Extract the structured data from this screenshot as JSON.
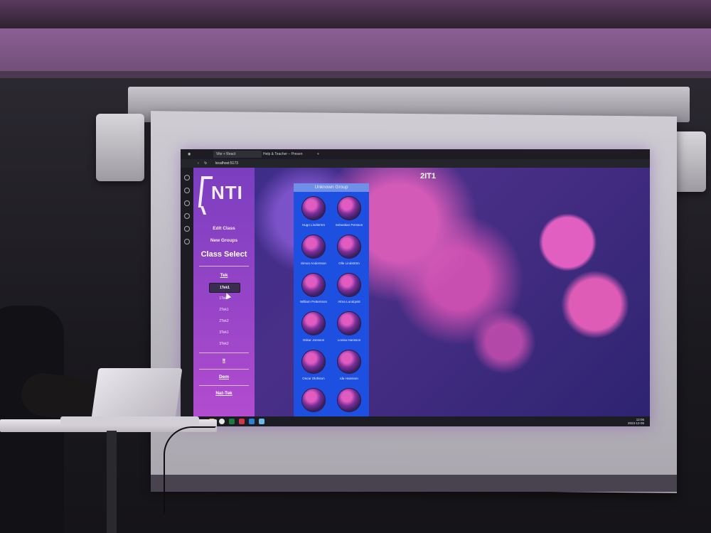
{
  "browser": {
    "tabs": [
      {
        "label": "Vite + React"
      },
      {
        "label": "Help & Teacher – Presen"
      }
    ],
    "new_tab": "+",
    "address": "localhost:5173"
  },
  "app": {
    "logo_text": "NTI",
    "nav": {
      "edit_class": "Edit Class",
      "new_groups": "New Groups"
    },
    "class_select_title": "Class Select",
    "groups": [
      {
        "label": "Tek"
      },
      {
        "label": "It"
      },
      {
        "label": "Dem"
      },
      {
        "label": "Nat-Tek"
      }
    ],
    "tek_classes": [
      {
        "label": "1Tek1",
        "selected": true
      },
      {
        "label": "1Tek2",
        "selected": false
      },
      {
        "label": "2Tek1",
        "selected": false
      },
      {
        "label": "2Tek2",
        "selected": false
      },
      {
        "label": "3Tek1",
        "selected": false
      },
      {
        "label": "3Tek2",
        "selected": false
      }
    ],
    "page_title": "2IT1",
    "group_panel": {
      "title": "Unknown Group",
      "students": [
        {
          "name": "Hugo Lindström"
        },
        {
          "name": "Sebastian Persson"
        },
        {
          "name": "Simon Andersson"
        },
        {
          "name": "Olle Lindström"
        },
        {
          "name": "William Pettersson"
        },
        {
          "name": "Alma Lundqvist"
        },
        {
          "name": "Oskar Jonsson"
        },
        {
          "name": "Lovisa Hansson"
        },
        {
          "name": "Oscar Olofsson"
        },
        {
          "name": "Ida Hansson"
        },
        {
          "name": ""
        },
        {
          "name": ""
        }
      ]
    }
  },
  "taskbar": {
    "time": "12:06",
    "date": "2023-12-05"
  },
  "colors": {
    "sidebar": "#9a45c8",
    "group_panel": "#1d4fe0",
    "accent_pink": "#d45ab8"
  }
}
